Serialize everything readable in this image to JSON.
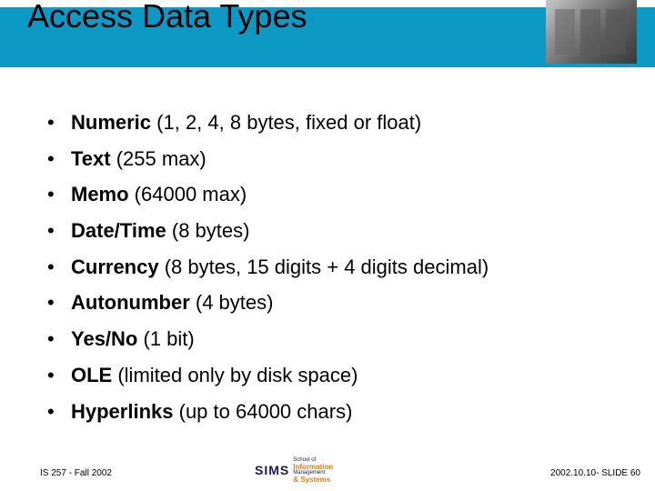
{
  "title": "Access Data Types",
  "bullets": [
    {
      "bold": "Numeric",
      "rest": " (1, 2, 4, 8 bytes, fixed or float)"
    },
    {
      "bold": "Text",
      "rest": " (255 max)"
    },
    {
      "bold": "Memo",
      "rest": " (64000 max)"
    },
    {
      "bold": "Date/Time",
      "rest": " (8 bytes)"
    },
    {
      "bold": "Currency",
      "rest": " (8 bytes, 15 digits + 4 digits decimal)"
    },
    {
      "bold": "Autonumber",
      "rest": " (4 bytes)"
    },
    {
      "bold": "Yes/No",
      "rest": " (1 bit)"
    },
    {
      "bold": "OLE",
      "rest": " (limited only by disk space)"
    },
    {
      "bold": "Hyperlinks",
      "rest": " (up to 64000 chars)"
    }
  ],
  "footer": {
    "left": "IS 257 - Fall 2002",
    "right": "2002.10.10- SLIDE 60",
    "logo_main": "SIMS",
    "logo_line1": "School of",
    "logo_line2": "Information",
    "logo_line3": "Management",
    "logo_line4": "& Systems"
  }
}
